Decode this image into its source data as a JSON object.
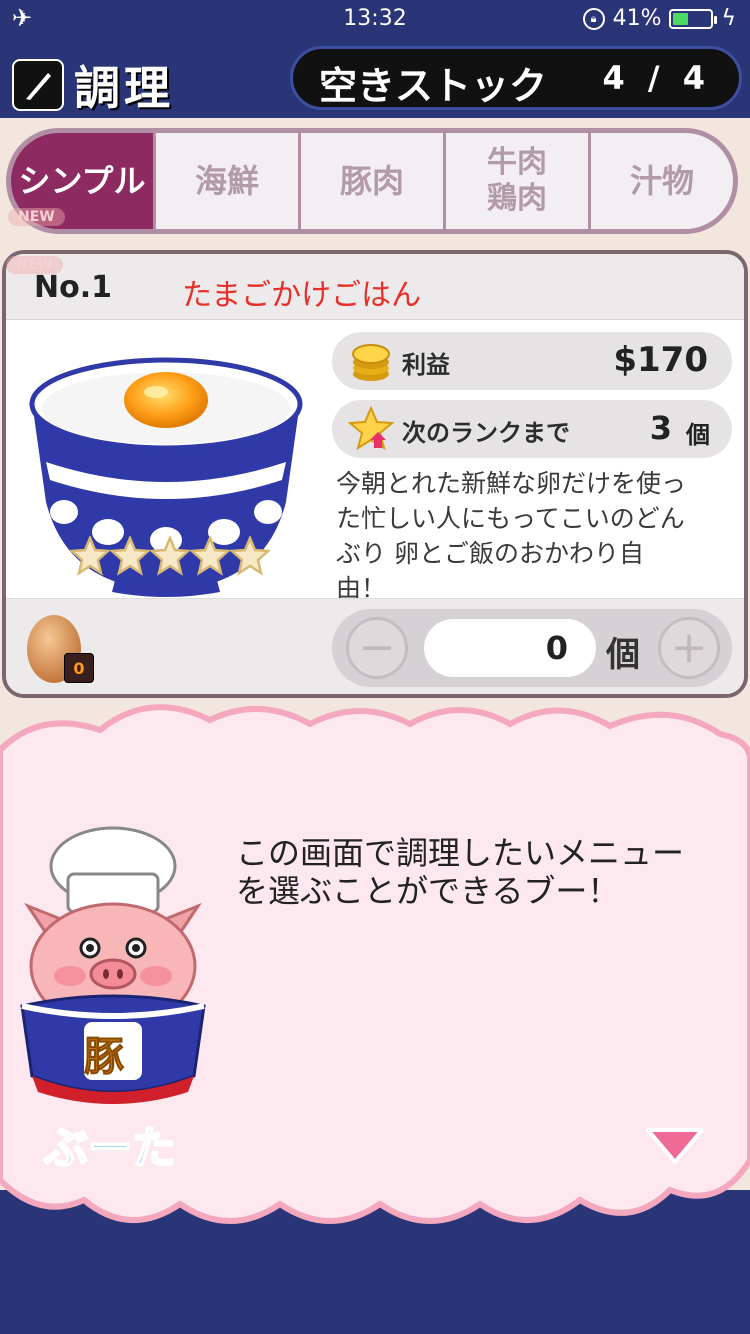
{
  "status_bar": {
    "time": "13:32",
    "battery_text": "41%",
    "battery_level": 0.41,
    "icons": [
      "airplane-icon",
      "orientation-lock-icon",
      "battery-icon",
      "charging-icon"
    ]
  },
  "header": {
    "title": "調理",
    "stock_label": "空きストック",
    "stock_count": "4 / 4"
  },
  "tabs": [
    {
      "label": "シンプル",
      "active": true
    },
    {
      "label": "海鮮",
      "active": false
    },
    {
      "label": "豚肉",
      "active": false
    },
    {
      "label": "牛肉\n鶏肉",
      "active": false
    },
    {
      "label": "汁物",
      "active": false
    }
  ],
  "badges": {
    "new_1": "NEW",
    "new_2": "NEW"
  },
  "recipe": {
    "number": "No.1",
    "name": "たまごかけごはん",
    "stars": 5,
    "profit_label": "利益",
    "profit_value": "$170",
    "rank_label": "次のランクまで",
    "rank_value": "3",
    "rank_unit": "個",
    "description": "今朝とれた新鮮な卵だけを使っ\nた忙しい人にもってこいのどん\nぶり 卵とご飯のおかわり自\n由！",
    "ingredient_count": "0",
    "quantity": "0",
    "quantity_unit": "個"
  },
  "dialog": {
    "text": "この画面で調理したいメニュー\nを選ぶことができるブー！",
    "speaker": "ぶーた",
    "speaker_badge": "豚"
  },
  "colors": {
    "header_bg": "#2a3578",
    "tab_active": "#8e2a62",
    "name_red": "#e8302b",
    "speaker_blue": "#34a8e8",
    "cloud_pink": "#fce8ee"
  }
}
